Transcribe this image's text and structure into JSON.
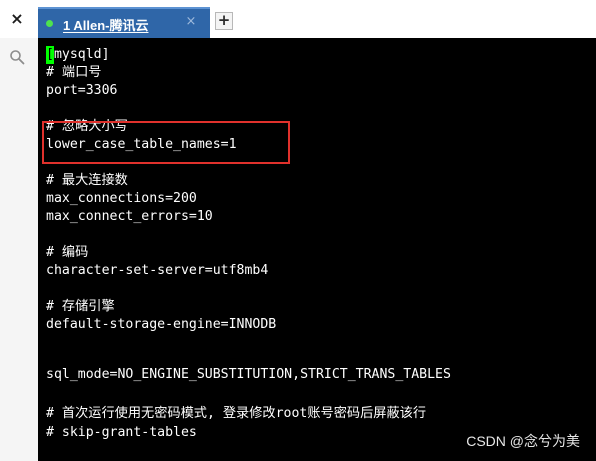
{
  "tabbar": {
    "close_all_glyph": "×",
    "tab": {
      "label": "1 Allen-腾讯云",
      "status_color": "#4ee24e",
      "close_glyph": "×"
    },
    "new_tab_glyph": "+"
  },
  "sidebar": {
    "search_icon": "search-icon"
  },
  "terminal": {
    "cursor_char": "[",
    "lines": [
      "mysqld]",
      "# 端口号",
      "port=3306",
      "",
      "# 忽略大小写",
      "lower_case_table_names=1",
      "",
      "# 最大连接数",
      "max_connections=200",
      "max_connect_errors=10",
      "",
      "# 编码",
      "character-set-server=utf8mb4",
      "",
      "# 存储引擎",
      "default-storage-engine=INNODB",
      "",
      "sql_mode=NO_ENGINE_SUBSTITUTION,STRICT_TRANS_TABLES",
      "",
      "# 首次运行使用无密码模式, 登录修改root账号密码后屏蔽该行",
      "# skip-grant-tables"
    ]
  },
  "colors": {
    "tab_background": "#2f66a8",
    "terminal_background": "#000000",
    "terminal_text": "#ffffff",
    "cursor": "#00ff00",
    "highlight_box": "#e0312c"
  },
  "watermark": "CSDN @念兮为美"
}
